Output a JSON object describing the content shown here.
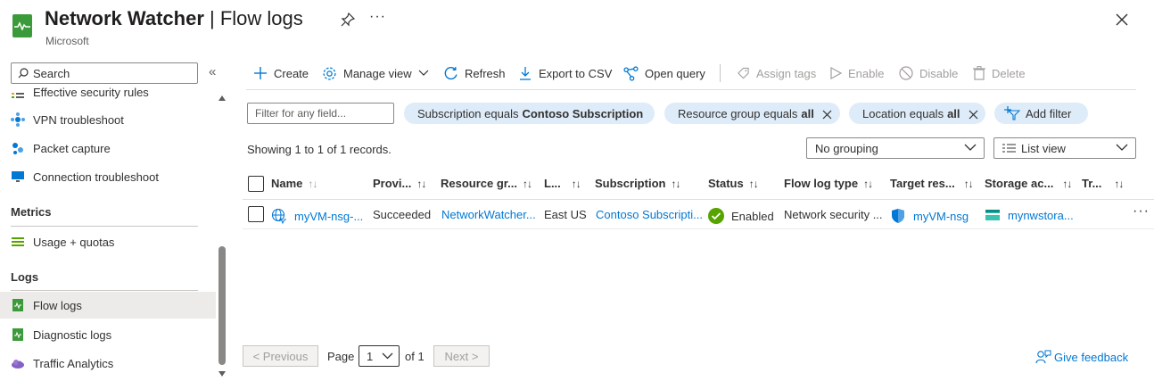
{
  "header": {
    "title_strong": "Network Watcher",
    "title_sep": " | ",
    "title_rest": "Flow logs",
    "subtitle": "Microsoft",
    "more": "···"
  },
  "sidebar": {
    "search_placeholder": "Search",
    "collapse": "«",
    "items": [
      {
        "label": "Effective security rules"
      },
      {
        "label": "VPN troubleshoot"
      },
      {
        "label": "Packet capture"
      },
      {
        "label": "Connection troubleshoot"
      }
    ],
    "metrics_heading": "Metrics",
    "metrics_items": [
      {
        "label": "Usage + quotas"
      }
    ],
    "logs_heading": "Logs",
    "logs_items": [
      {
        "label": "Flow logs"
      },
      {
        "label": "Diagnostic logs"
      },
      {
        "label": "Traffic Analytics"
      }
    ]
  },
  "toolbar": {
    "create": "Create",
    "manage_view": "Manage view",
    "refresh": "Refresh",
    "export": "Export to CSV",
    "open_query": "Open query",
    "assign_tags": "Assign tags",
    "enable": "Enable",
    "disable": "Disable",
    "delete": "Delete"
  },
  "filters": {
    "placeholder": "Filter for any field...",
    "pills": [
      {
        "prefix": "Subscription equals",
        "value": "Contoso Subscription"
      },
      {
        "prefix": "Resource group equals",
        "value": "all"
      },
      {
        "prefix": "Location equals",
        "value": "all"
      }
    ],
    "add_filter": "Add filter"
  },
  "records_text": "Showing 1 to 1 of 1 records.",
  "grouping": {
    "selected": "No grouping"
  },
  "view": {
    "selected": "List view"
  },
  "table": {
    "columns": [
      "Name",
      "Provi...",
      "Resource gr...",
      "L...",
      "Subscription",
      "Status",
      "Flow log type",
      "Target res...",
      "Storage ac...",
      "Tr..."
    ],
    "rows": [
      {
        "name": "myVM-nsg-...",
        "provisioning": "Succeeded",
        "resource_group": "NetworkWatcher...",
        "location": "East US",
        "subscription": "Contoso Subscripti...",
        "status": "Enabled",
        "flow_log_type": "Network security ...",
        "target_resource": "myVM-nsg",
        "storage_account": "mynwstora..."
      }
    ],
    "row_more": "···"
  },
  "pagination": {
    "previous": "< Previous",
    "page_label": "Page",
    "page_value": "1",
    "of_label": "of 1",
    "next": "Next >"
  },
  "feedback": "Give feedback",
  "colors": {
    "accent": "#0078d4",
    "pill_bg": "#deecf9",
    "success": "#57a300",
    "active_item": "#edebe9"
  }
}
